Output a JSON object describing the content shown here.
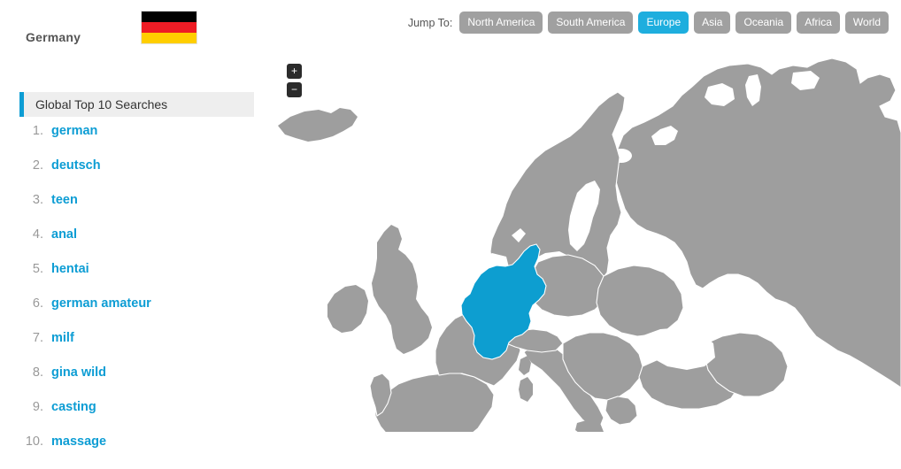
{
  "country": {
    "name": "Germany",
    "flag_colors": [
      "#000000",
      "#ee1c25",
      "#ffce00"
    ],
    "highlight_color": "#0d9ed0"
  },
  "list_panel": {
    "title": "Global Top 10 Searches",
    "accent_color": "#0d9dd4",
    "items": [
      {
        "rank": "1.",
        "term": "german"
      },
      {
        "rank": "2.",
        "term": "deutsch"
      },
      {
        "rank": "3.",
        "term": "teen"
      },
      {
        "rank": "4.",
        "term": "anal"
      },
      {
        "rank": "5.",
        "term": "hentai"
      },
      {
        "rank": "6.",
        "term": "german amateur"
      },
      {
        "rank": "7.",
        "term": "milf"
      },
      {
        "rank": "8.",
        "term": "gina wild"
      },
      {
        "rank": "9.",
        "term": "casting"
      },
      {
        "rank": "10.",
        "term": "massage"
      }
    ]
  },
  "jump_to": {
    "label": "Jump To:",
    "active_color": "#1eaede",
    "inactive_color": "#a0a0a0",
    "buttons": [
      {
        "label": "North America",
        "active": false
      },
      {
        "label": "South America",
        "active": false
      },
      {
        "label": "Europe",
        "active": true
      },
      {
        "label": "Asia",
        "active": false
      },
      {
        "label": "Oceania",
        "active": false
      },
      {
        "label": "Africa",
        "active": false
      },
      {
        "label": "World",
        "active": false
      }
    ]
  },
  "map": {
    "region": "Europe",
    "land_color": "#9e9e9e",
    "border_color": "#ffffff",
    "ocean_color": "#ffffff",
    "zoom_in_label": "+",
    "zoom_out_label": "−"
  }
}
